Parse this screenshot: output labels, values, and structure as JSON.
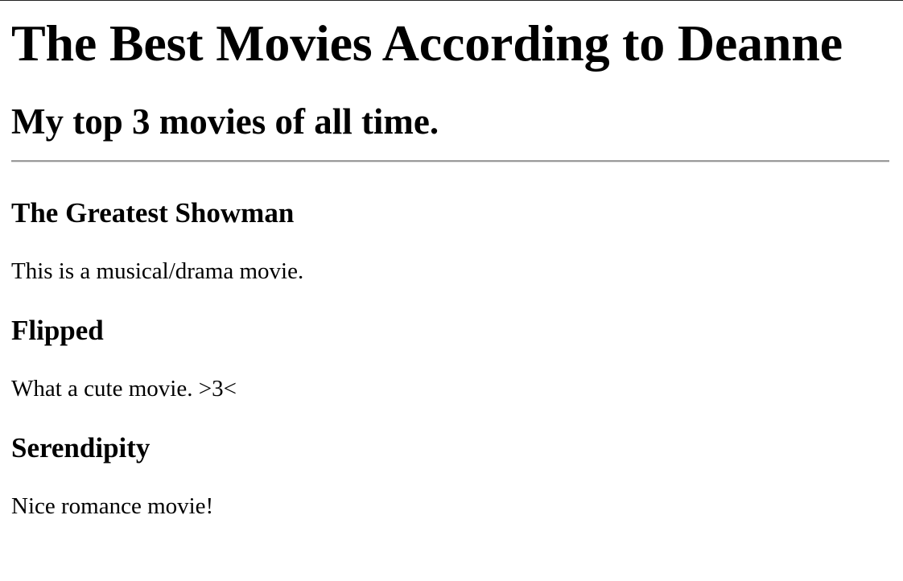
{
  "page": {
    "title": "The Best Movies According to Deanne",
    "subtitle": "My top 3 movies of all time."
  },
  "movies": [
    {
      "title": "The Greatest Showman",
      "description": "This is a musical/drama movie."
    },
    {
      "title": "Flipped",
      "description": "What a cute movie. >3<"
    },
    {
      "title": "Serendipity",
      "description": "Nice romance movie!"
    }
  ],
  "colors": {
    "background": "#ffffff",
    "text": "#000000",
    "rule": "#9a9a9a"
  }
}
